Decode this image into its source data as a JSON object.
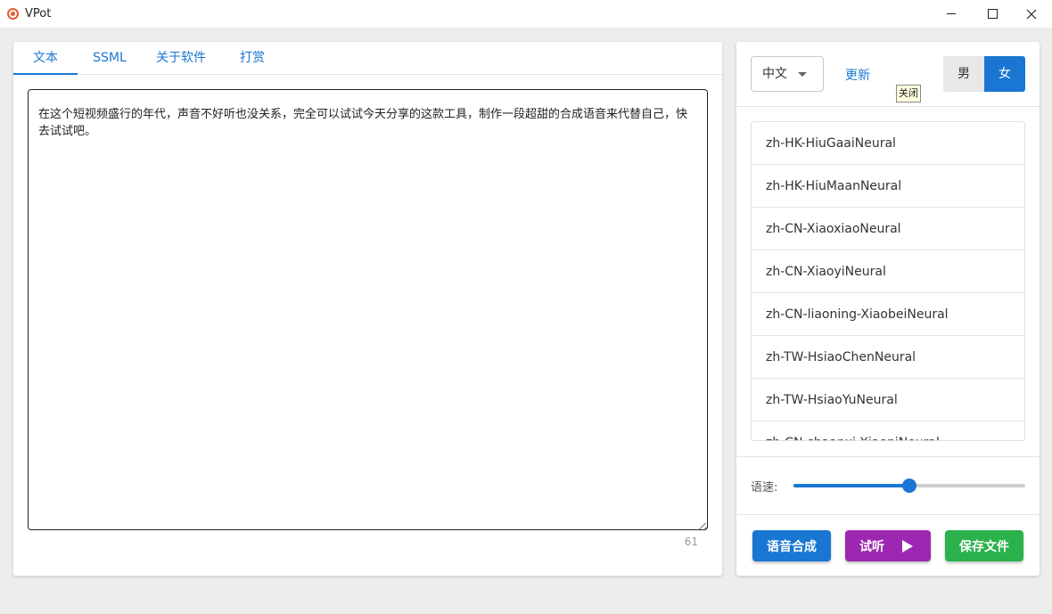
{
  "window": {
    "title": "VPot",
    "icon": "vpot-logo-icon",
    "controls": [
      "minimize-icon",
      "maximize-icon",
      "close-icon"
    ]
  },
  "tabs": [
    {
      "label": "文本",
      "active": true
    },
    {
      "label": "SSML",
      "active": false
    },
    {
      "label": "关于软件",
      "active": false
    },
    {
      "label": "打赏",
      "active": false
    }
  ],
  "editor": {
    "text": "在这个短视频盛行的年代，声音不好听也没关系，完全可以试试今天分享的这款工具，制作一段超甜的合成语音来代替自己，快去试试吧。",
    "char_count": "61"
  },
  "settings": {
    "language": "中文",
    "refresh_label": "更新",
    "tooltip": "关闭",
    "gender_male": "男",
    "gender_female": "女",
    "gender_selected": "女"
  },
  "voices": [
    "zh-HK-HiuGaaiNeural",
    "zh-HK-HiuMaanNeural",
    "zh-CN-XiaoxiaoNeural",
    "zh-CN-XiaoyiNeural",
    "zh-CN-liaoning-XiaobeiNeural",
    "zh-TW-HsiaoChenNeural",
    "zh-TW-HsiaoYuNeural",
    "zh-CN-shaanxi-XiaoniNeural"
  ],
  "speed": {
    "label": "语速:",
    "value": 0.5
  },
  "actions": {
    "synthesize": "语音合成",
    "listen": "试听",
    "save": "保存文件"
  },
  "colors": {
    "primary": "#1976d2",
    "purple": "#9c27b0",
    "green": "#2bb24c"
  }
}
